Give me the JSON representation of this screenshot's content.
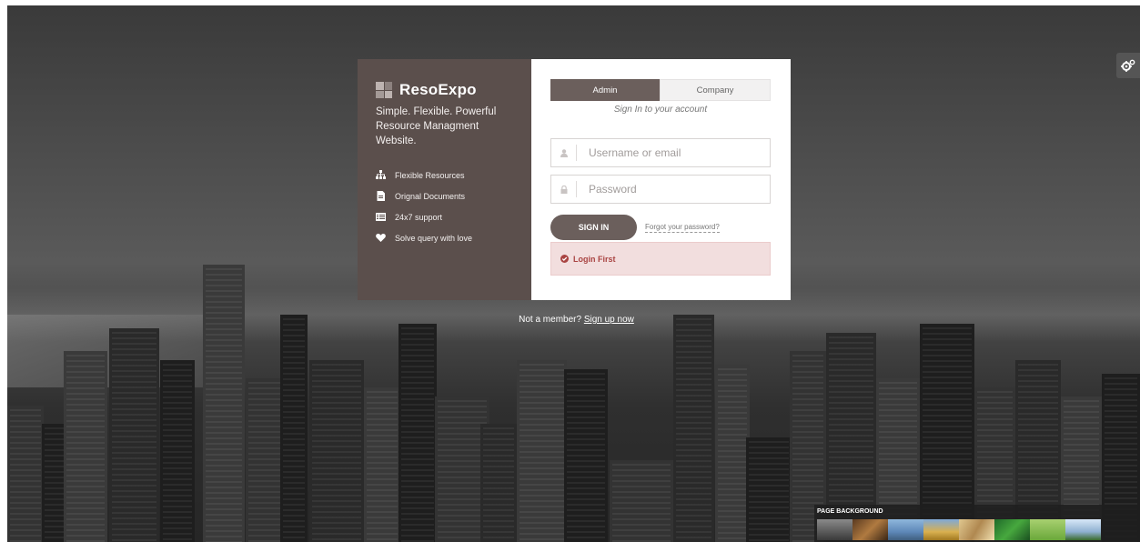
{
  "brand": {
    "name": "ResoExpo",
    "tagline": "Simple. Flexible. Powerful Resource Managment Website."
  },
  "features": [
    {
      "label": "Flexible Resources",
      "icon": "sitemap-icon"
    },
    {
      "label": "Orignal Documents",
      "icon": "document-icon"
    },
    {
      "label": "24x7 support",
      "icon": "list-icon"
    },
    {
      "label": "Solve query with love",
      "icon": "heart-icon"
    }
  ],
  "tabs": [
    {
      "label": "Admin",
      "active": true
    },
    {
      "label": "Company",
      "active": false
    }
  ],
  "login": {
    "subtitle": "Sign In to your account",
    "username_placeholder": "Username or email",
    "password_placeholder": "Password",
    "signin_label": "SIGN IN",
    "forgot_label": "Forgot your password?",
    "alert_text": "Login First"
  },
  "signup": {
    "prompt": "Not a member?",
    "link": "Sign up now"
  },
  "page_background": {
    "title": "PAGE BACKGROUND",
    "thumbnails": [
      "city",
      "market",
      "mountains",
      "sunset-field",
      "wheat",
      "green-leaves",
      "grass-field",
      "tree-sky"
    ]
  },
  "colors": {
    "accent": "#6b5f5c",
    "promo_bg": "#5b4f4c",
    "alert_bg": "#f2dede",
    "alert_text": "#a94442"
  }
}
